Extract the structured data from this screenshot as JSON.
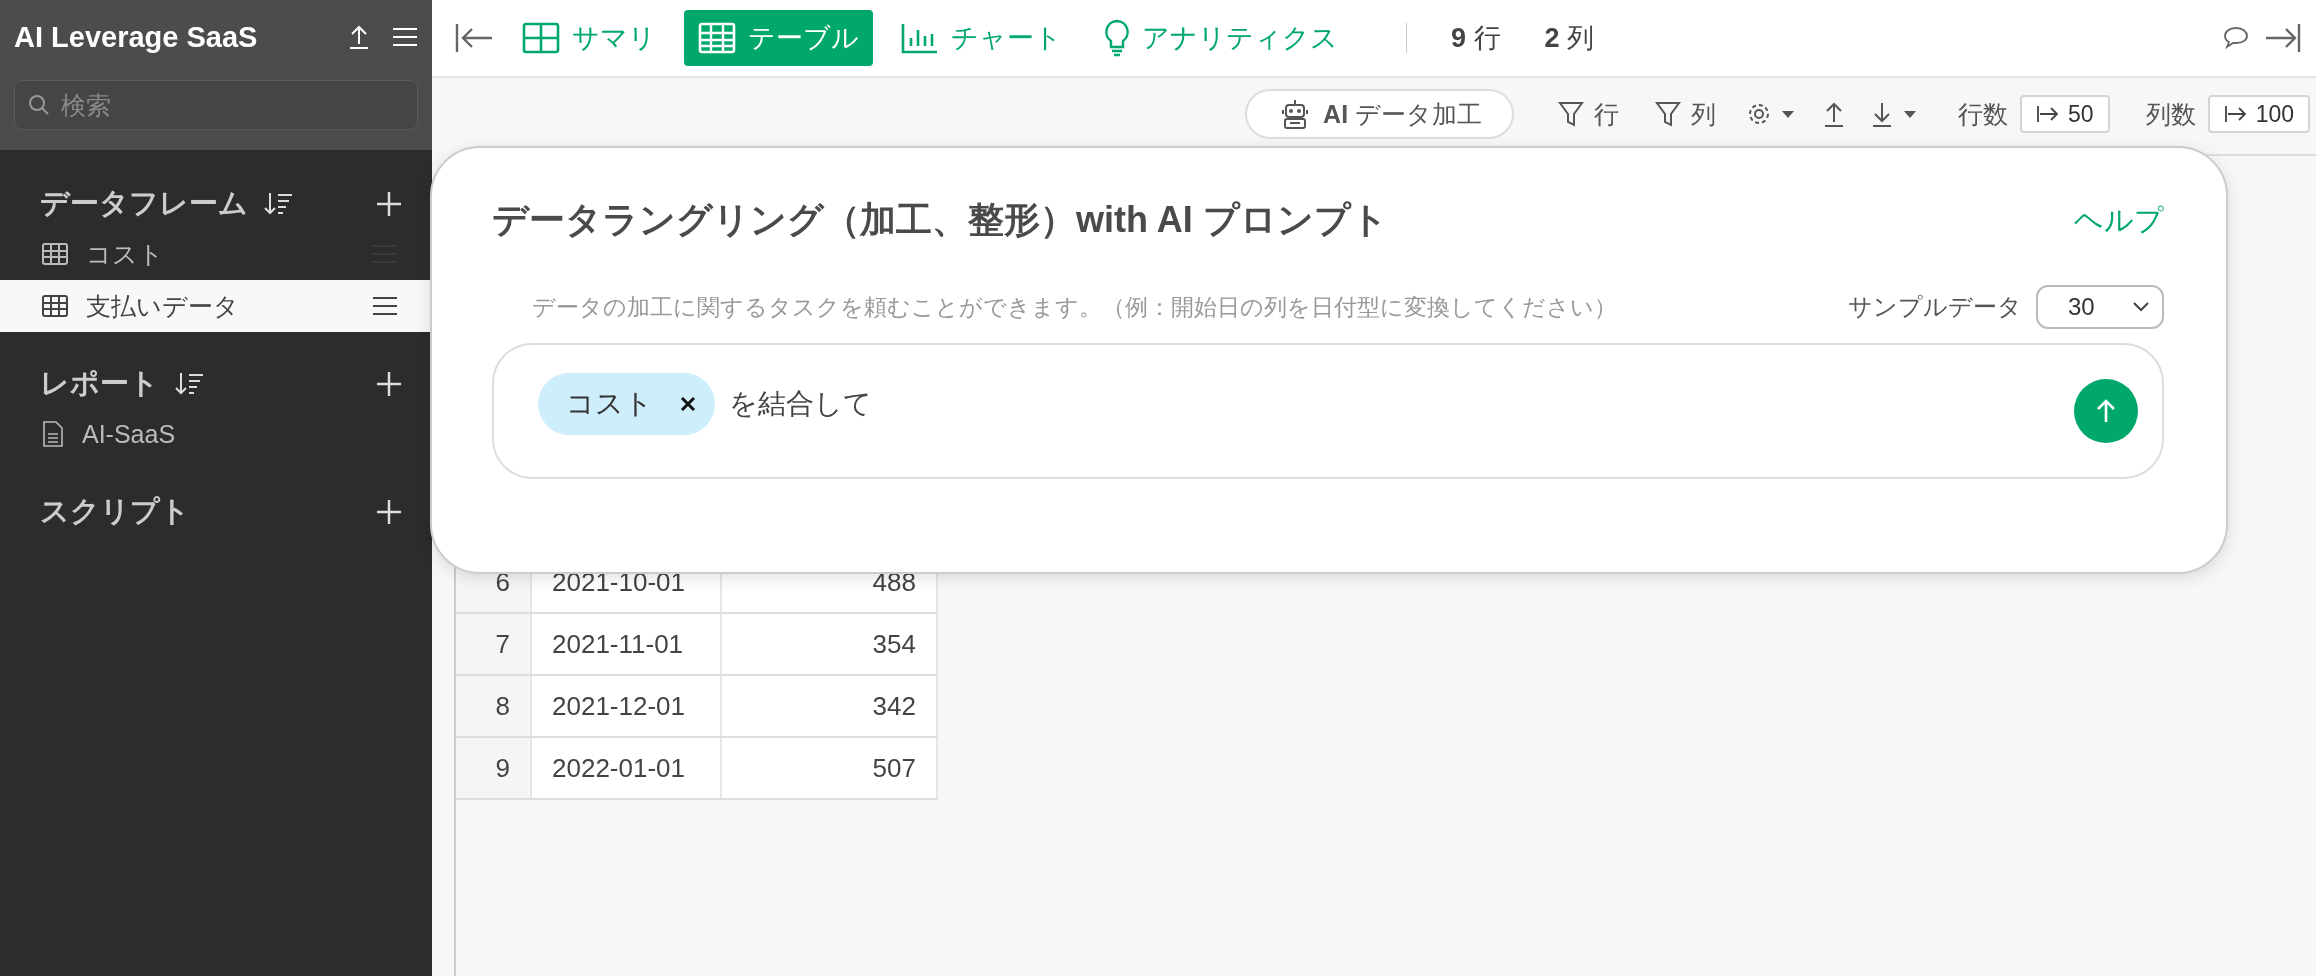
{
  "sidebar": {
    "title": "AI Leverage SaaS",
    "search": {
      "placeholder": "検索"
    },
    "sections": [
      {
        "title": "データフレーム",
        "sortable": true,
        "items": [
          {
            "label": "コスト",
            "kind": "table",
            "selected": false
          },
          {
            "label": "支払いデータ",
            "kind": "table",
            "selected": true
          }
        ]
      },
      {
        "title": "レポート",
        "sortable": true,
        "items": [
          {
            "label": "AI-SaaS",
            "kind": "document",
            "selected": false
          }
        ]
      },
      {
        "title": "スクリプト",
        "sortable": false
      }
    ]
  },
  "toolbar": {
    "tabs": [
      {
        "label": "サマリ",
        "kind": "summary",
        "selected": false
      },
      {
        "label": "テーブル",
        "kind": "table",
        "selected": true
      },
      {
        "label": "チャート",
        "kind": "chart",
        "selected": false
      },
      {
        "label": "アナリティクス",
        "kind": "analytics",
        "selected": false
      }
    ],
    "counts": [
      {
        "value": "9",
        "unit": "行"
      },
      {
        "value": "2",
        "unit": "列"
      }
    ]
  },
  "subtoolbar": {
    "ai_button": "**AI** データ加工",
    "row_filter": "行",
    "column_filter": "列",
    "row_limit": {
      "label": "行数",
      "value": "50"
    },
    "column_limit": {
      "label": "列数",
      "value": "100"
    }
  },
  "dialog": {
    "title": "データラングリング（加工、整形）with AI プロンプト",
    "help": "ヘルプ",
    "description": "データの加工に関するタスクを頼むことができます。（例：開始日の列を日付型に変換してください）",
    "sample_label": "サンプルデータ",
    "sample_value": "30",
    "prompt": {
      "chip": "コスト",
      "text": "を結合して"
    }
  },
  "table": {
    "rows": [
      {
        "index": "6",
        "date": "2021-10-01",
        "value": "488"
      },
      {
        "index": "7",
        "date": "2021-11-01",
        "value": "354"
      },
      {
        "index": "8",
        "date": "2021-12-01",
        "value": "342"
      },
      {
        "index": "9",
        "date": "2022-01-01",
        "value": "507"
      }
    ]
  }
}
